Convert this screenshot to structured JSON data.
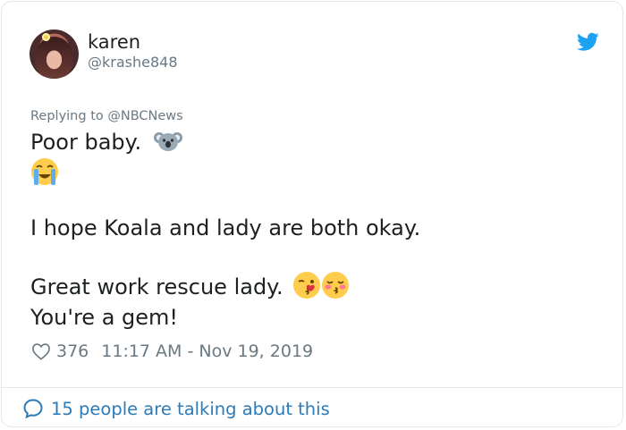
{
  "user": {
    "name": "karen",
    "handle": "@krashe848"
  },
  "reply": {
    "prefix": "Replying to ",
    "mention": "@NBCNews"
  },
  "tweet": {
    "line1": "Poor baby.",
    "line3": "I hope Koala and lady are both okay.",
    "line4": "Great work rescue lady.",
    "line5": "You're a gem!"
  },
  "icons": {
    "bird": "twitter-bird-icon",
    "koala": "koala-emoji",
    "crying": "loudly-crying-face-emoji",
    "kiss_wink": "face-blowing-kiss-emoji",
    "kiss_blush": "kissing-face-closed-eyes-emoji",
    "heart": "heart-outline-icon",
    "bubble": "speech-bubble-icon"
  },
  "meta": {
    "likes": "376",
    "timestamp": "11:17 AM - Nov 19, 2019"
  },
  "footer": {
    "talking": "15 people are talking about this"
  },
  "colors": {
    "accent": "#1da1f2",
    "link": "#2b7bb9",
    "muted": "#697882",
    "text": "#1c2022",
    "border": "#e1e8ed"
  }
}
